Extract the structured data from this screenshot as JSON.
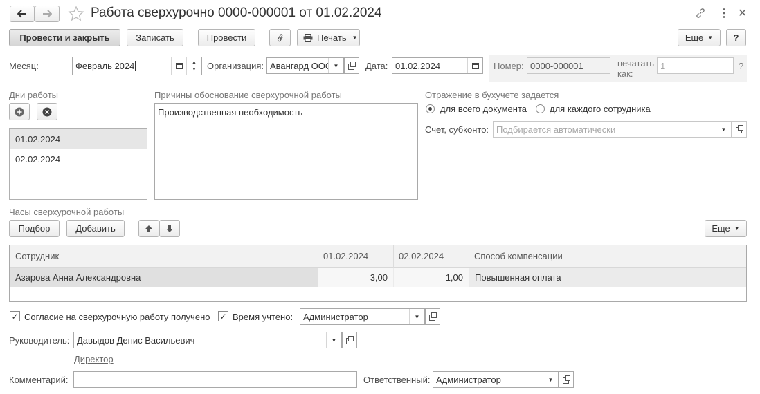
{
  "window": {
    "title": "Работа сверхурочно 0000-000001 от 01.02.2024"
  },
  "toolbar": {
    "post_close": "Провести и закрыть",
    "save": "Записать",
    "post": "Провести",
    "print": "Печать",
    "more": "Еще",
    "help": "?"
  },
  "header": {
    "month_label": "Месяц:",
    "month_value": "Февраль 2024",
    "org_label": "Организация:",
    "org_value": "Авангард ООО",
    "date_label": "Дата:",
    "date_value": "01.02.2024",
    "number_label": "Номер:",
    "number_value": "0000-000001",
    "print_as_label_1": "печатать",
    "print_as_label_2": "как:",
    "print_as_placeholder": "1",
    "print_as_help": "?"
  },
  "work_days": {
    "title": "Дни работы",
    "items": [
      "01.02.2024",
      "02.02.2024"
    ]
  },
  "reasons": {
    "title": "Причины обоснование сверхурочной работы",
    "text": "Производственная необходимость"
  },
  "accounting": {
    "title": "Отражение в бухучете задается",
    "option_all": "для всего документа",
    "option_each": "для каждого сотрудника",
    "account_label": "Счет, субконто:",
    "account_placeholder": "Подбирается автоматически"
  },
  "hours": {
    "title": "Часы сверхурочной работы",
    "pick": "Подбор",
    "add": "Добавить",
    "more": "Еще",
    "columns": [
      "Сотрудник",
      "01.02.2024",
      "02.02.2024",
      "Способ компенсации"
    ],
    "rows": [
      {
        "employee": "Азарова Анна Александровна",
        "d1": "3,00",
        "d2": "1,00",
        "compensation": "Повышенная оплата"
      }
    ]
  },
  "footer": {
    "consent_label": "Согласие на сверхурочную работу получено",
    "time_label": "Время учтено:",
    "time_value": "Администратор",
    "manager_label": "Руководитель:",
    "manager_value": "Давыдов Денис Васильевич",
    "manager_position": "Директор",
    "comment_label": "Комментарий:",
    "comment_value": "",
    "responsible_label": "Ответственный:",
    "responsible_value": "Администратор"
  }
}
